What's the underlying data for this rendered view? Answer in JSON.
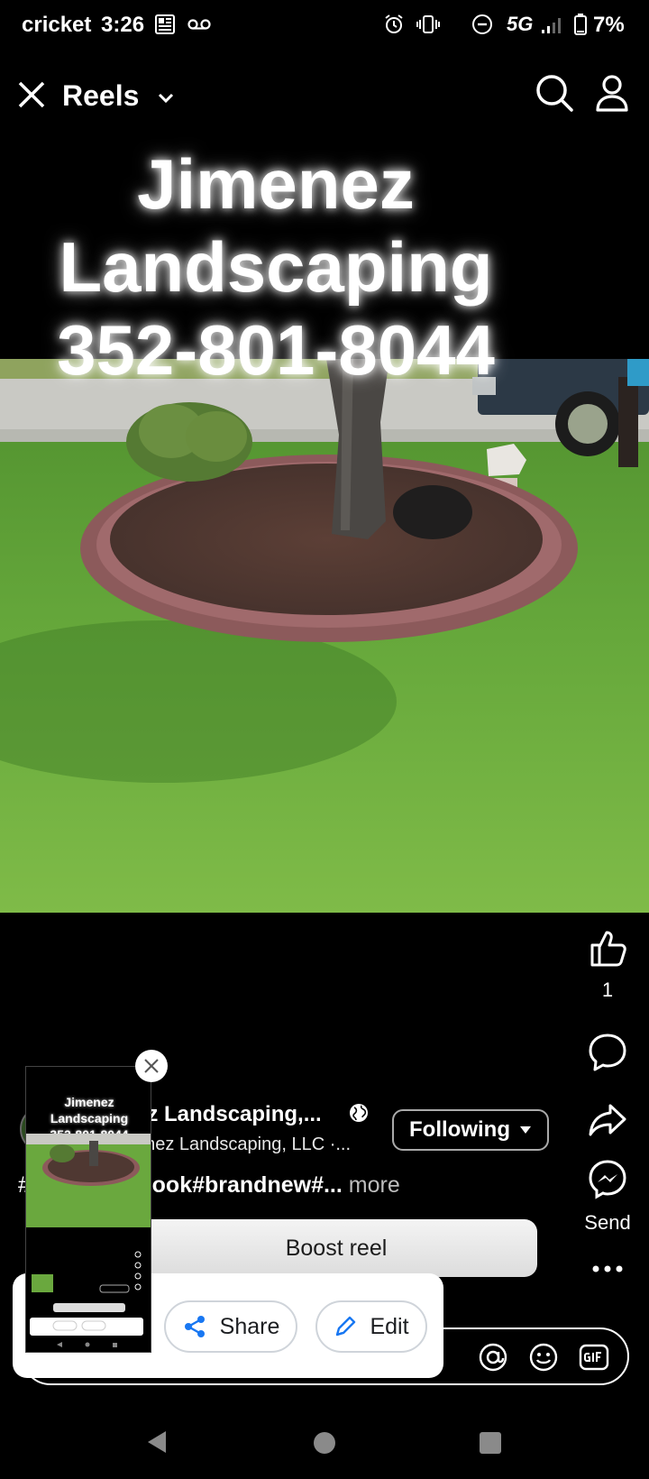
{
  "status_bar": {
    "carrier": "cricket",
    "time": "3:26",
    "network": "5G",
    "battery": "7%"
  },
  "header": {
    "title": "Reels"
  },
  "overlay": {
    "line1": "Jimenez",
    "line2": "Landscaping",
    "line3": "352-801-8044"
  },
  "actions": {
    "like_count": "1",
    "send_label": "Send"
  },
  "post": {
    "author_name": "ez Landscaping,...",
    "author_sub": "enez Landscaping, LLC ·...",
    "following_label": "Following",
    "caption_prefix": "#",
    "caption_tags": "bing#freshlook#brandnew#...",
    "caption_more": "more",
    "boost_label": "Boost reel"
  },
  "share_popup": {
    "share_label": "Share",
    "edit_label": "Edit"
  },
  "pip": {
    "line1": "Jimenez",
    "line2": "Landscaping",
    "line3": "352-801-8044"
  },
  "colors": {
    "accent": "#1877f2",
    "background": "#000000",
    "grass": "#5fa33a"
  }
}
